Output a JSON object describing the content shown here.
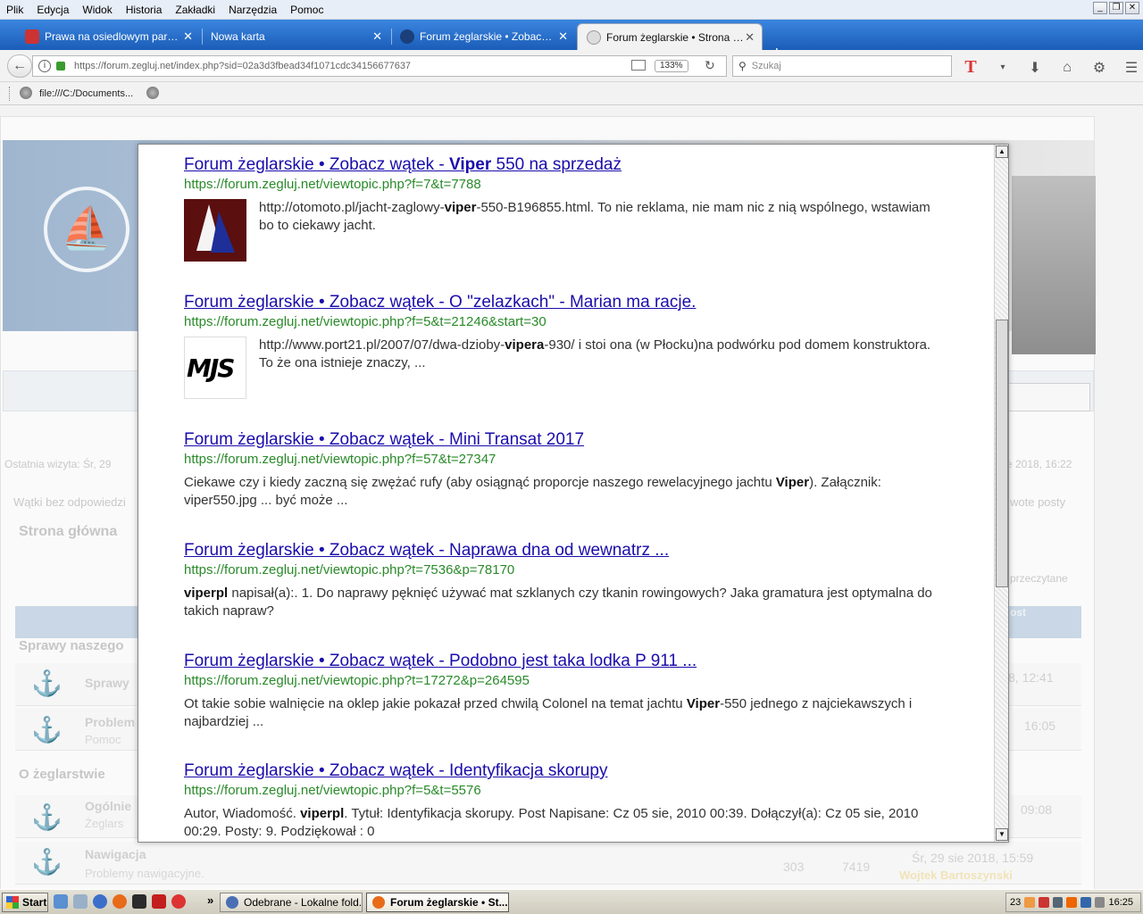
{
  "menubar": {
    "items": [
      {
        "label": "Plik"
      },
      {
        "label": "Edycja"
      },
      {
        "label": "Widok"
      },
      {
        "label": "Historia"
      },
      {
        "label": "Zakładki"
      },
      {
        "label": "Narzędzia"
      },
      {
        "label": "Pomoc"
      }
    ]
  },
  "tabs": [
    {
      "title": "Prawa na osiedlowym parking..."
    },
    {
      "title": "Nowa karta"
    },
    {
      "title": "Forum żeglarskie • Zobacz wą..."
    },
    {
      "title": "Forum żeglarskie • Strona głó..."
    }
  ],
  "navbar": {
    "url": "https://forum.zegluj.net/index.php?sid=02a3d3fbead34f1071cdc34156677637",
    "zoom": "133%",
    "search_placeholder": "Szukaj"
  },
  "bookmarks": {
    "item_label": "file:///C:/Documents..."
  },
  "background_page": {
    "last_visit": "Ostatnia wizyta: Śr, 29",
    "date_right": "e 2018, 16:22",
    "unanswered": "Wątki bez odpowiedzi",
    "new_posts": "wote posty",
    "breadcrumb": "Strona główna",
    "mark_read": "przeczytane",
    "cat_right": "ost",
    "section1": "Sprawy naszego",
    "section2": "O żeglarstwie",
    "rows": [
      {
        "title": "Sprawy",
        "subtitle": "",
        "date": "8, 12:41"
      },
      {
        "title": "Problem",
        "subtitle": "Pomoc",
        "date": "16:05"
      },
      {
        "title": "Ogólnie",
        "subtitle": "Żeglars",
        "date": "09:08"
      },
      {
        "title": "Nawigacja",
        "subtitle": "Problemy nawigacyjne.",
        "topics": "303",
        "posts": "7419",
        "date": "Śr, 29 sie 2018, 15:59",
        "author": "Wojtek Bartoszynski"
      }
    ]
  },
  "results": [
    {
      "title": "Forum żeglarskie • Zobacz wątek - ",
      "title_bold": "Viper",
      "title_rest": " 550 na sprzedaż",
      "url": "https://forum.zegluj.net/viewtopic.php?f=7&t=7788",
      "snippet_a": "http://otomoto.pl/jacht-zaglowy-",
      "snippet_bold": "viper",
      "snippet_b": "-550-B196855.html. To nie reklama, nie mam nic z nią wspólnego, wstawiam bo to ciekawy jacht."
    },
    {
      "title": "Forum żeglarskie • Zobacz wątek - O \"zelazkach\" - Marian ma racje.",
      "url": "https://forum.zegluj.net/viewtopic.php?f=5&t=21246&start=30",
      "snippet_a": "http://www.port21.pl/2007/07/dwa-dzioby-",
      "snippet_bold": "vipera",
      "snippet_b": "-930/ i stoi ona (w Płocku)na podwórku pod domem konstruktora. To że ona istnieje znaczy, ...",
      "thumb_text": "MJS"
    },
    {
      "title": "Forum żeglarskie • Zobacz wątek - Mini Transat 2017",
      "url": "https://forum.zegluj.net/viewtopic.php?f=57&t=27347",
      "snippet_a": "Ciekawe czy i kiedy zaczną się zwężać rufy (aby osiągnąć proporcje naszego rewelacyjnego jachtu ",
      "snippet_bold": "Viper",
      "snippet_b": "). Załącznik: viper550.jpg ... być może ..."
    },
    {
      "title": "Forum żeglarskie • Zobacz wątek - Naprawa dna od wewnatrz ...",
      "url": "https://forum.zegluj.net/viewtopic.php?t=7536&p=78170",
      "snippet_a": "",
      "snippet_bold": "viperpl",
      "snippet_b": " napisał(a):. 1. Do naprawy pęknięć używać mat szklanych czy tkanin rowingowych? Jaka gramatura jest optymalna do takich napraw?"
    },
    {
      "title": "Forum żeglarskie • Zobacz wątek - Podobno jest taka lodka P 911 ...",
      "url": "https://forum.zegluj.net/viewtopic.php?t=17272&p=264595",
      "snippet_a": "Ot takie sobie walnięcie na oklep jakie pokazał przed chwilą Colonel na temat jachtu ",
      "snippet_bold": "Viper",
      "snippet_b": "-550 jednego z najciekawszych i najbardziej ..."
    },
    {
      "title": "Forum żeglarskie • Zobacz wątek - Identyfikacja skorupy",
      "url": "https://forum.zegluj.net/viewtopic.php?f=5&t=5576",
      "snippet_a": "Autor, Wiadomość. ",
      "snippet_bold": "viperpl",
      "snippet_b": ". Tytuł: Identyfikacja skorupy. Post Napisane: Cz 05 sie, 2010 00:39. Dołączył(a): Cz 05 sie, 2010 00:29. Posty: 9. Podziękował : 0"
    }
  ],
  "taskbar": {
    "start_label": "Start",
    "tasks": [
      {
        "label": "Odebrane - Lokalne fold..."
      },
      {
        "label": "Forum żeglarskie • St..."
      }
    ],
    "tray_num": "23",
    "clock": "16:25"
  },
  "colors": {
    "link": "#1a0dab",
    "url_green": "#2a8a2a",
    "tabstrip": "#1b5db8"
  }
}
